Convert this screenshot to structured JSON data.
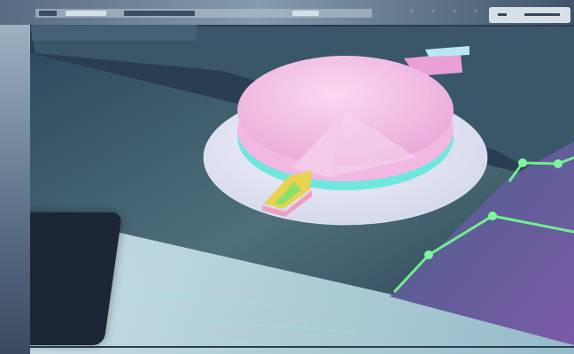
{
  "scene": {
    "colors": {
      "disc_top": "#f4c2e6",
      "disc_band": "#6ee7df",
      "disc_slice": "#e9d24f",
      "base_plate": "#e9eef6",
      "desk": "#4e707a",
      "graph_panel": "#6a5a99",
      "graph_line": "#6ff08e",
      "accent_pink": "#e76b8d"
    }
  }
}
